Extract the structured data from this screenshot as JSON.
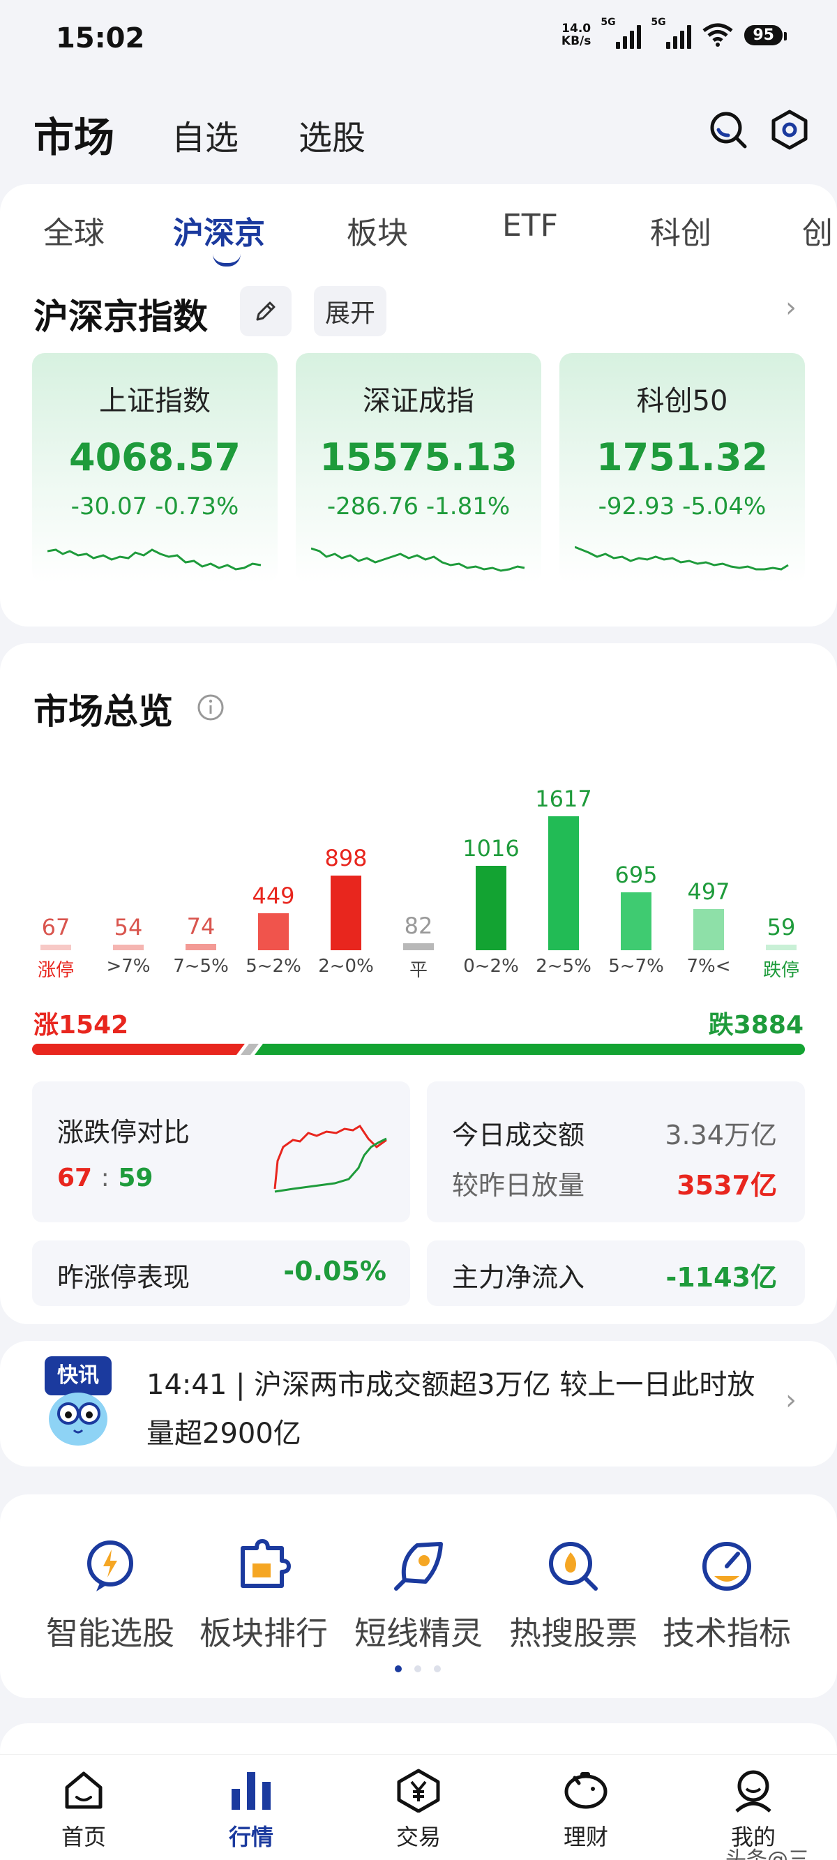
{
  "status_bar": {
    "time": "15:02",
    "net_speed_value": "14.0",
    "net_speed_unit": "KB/s",
    "sim1": "5G",
    "sim2": "5G",
    "battery": "95"
  },
  "header": {
    "title": "市场",
    "tabs": [
      "自选",
      "选股"
    ],
    "icons": [
      "search-icon",
      "settings-hexagon-icon"
    ]
  },
  "market_tabs": {
    "items": [
      "全球",
      "沪深京",
      "板块",
      "ETF",
      "科创",
      "创"
    ],
    "active": "沪深京"
  },
  "indices_section": {
    "title": "沪深京指数",
    "expand_label": "展开",
    "cards": [
      {
        "name": "上证指数",
        "value": "4068.57",
        "change": "-30.07",
        "pct": "-0.73%"
      },
      {
        "name": "深证成指",
        "value": "15575.13",
        "change": "-286.76",
        "pct": "-1.81%"
      },
      {
        "name": "科创50",
        "value": "1751.32",
        "change": "-92.93",
        "pct": "-5.04%"
      }
    ]
  },
  "overview": {
    "title": "市场总览",
    "distribution": [
      {
        "label": "涨停",
        "count": 67,
        "color": "#f7c9c6"
      },
      {
        "label": ">7%",
        "count": 54,
        "color": "#f5b5b1"
      },
      {
        "label": "7~5%",
        "count": 74,
        "color": "#f39a95"
      },
      {
        "label": "5~2%",
        "count": 449,
        "color": "#f0544c"
      },
      {
        "label": "2~0%",
        "count": 898,
        "color": "#e8261e"
      },
      {
        "label": "平",
        "count": 82,
        "color": "#b8b8b8"
      },
      {
        "label": "0~2%",
        "count": 1016,
        "color": "#13a332"
      },
      {
        "label": "2~5%",
        "count": 1617,
        "color": "#22bb55"
      },
      {
        "label": "5~7%",
        "count": 695,
        "color": "#3fcb71"
      },
      {
        "label": "7%<",
        "count": 497,
        "color": "#8ee0a8"
      },
      {
        "label": "跌停",
        "count": 59,
        "color": "#c9f0d6"
      }
    ],
    "rise_label": "涨1542",
    "fall_label": "跌3884",
    "rise_count": 1542,
    "fall_count": 3884,
    "limit_compare": {
      "label": "涨跌停对比",
      "up": "67",
      "sep": ":",
      "down": "59"
    },
    "turnover": {
      "label": "今日成交额",
      "value": "3.34万亿",
      "vs_label": "较昨日放量",
      "vs_value": "3537亿"
    },
    "yesterday_limit": {
      "label": "昨涨停表现",
      "value": "-0.05%"
    },
    "main_flow": {
      "label": "主力净流入",
      "value": "-1143亿"
    }
  },
  "news": {
    "badge": "快讯",
    "text": "14:41 | 沪深两市成交额超3万亿 较上一日此时放量超2900亿"
  },
  "shortcuts": [
    {
      "label": "智能选股",
      "icon": "lightning-bubble-icon"
    },
    {
      "label": "板块排行",
      "icon": "puzzle-icon"
    },
    {
      "label": "短线精灵",
      "icon": "rocket-icon"
    },
    {
      "label": "热搜股票",
      "icon": "hot-search-icon"
    },
    {
      "label": "技术指标",
      "icon": "gauge-icon"
    }
  ],
  "bottom_nav": [
    {
      "label": "首页",
      "icon": "home-icon"
    },
    {
      "label": "行情",
      "icon": "market-bars-icon"
    },
    {
      "label": "交易",
      "icon": "trade-yen-icon"
    },
    {
      "label": "理财",
      "icon": "piggy-bank-icon"
    },
    {
      "label": "我的",
      "icon": "profile-icon"
    }
  ],
  "watermark": "头条@三"
}
